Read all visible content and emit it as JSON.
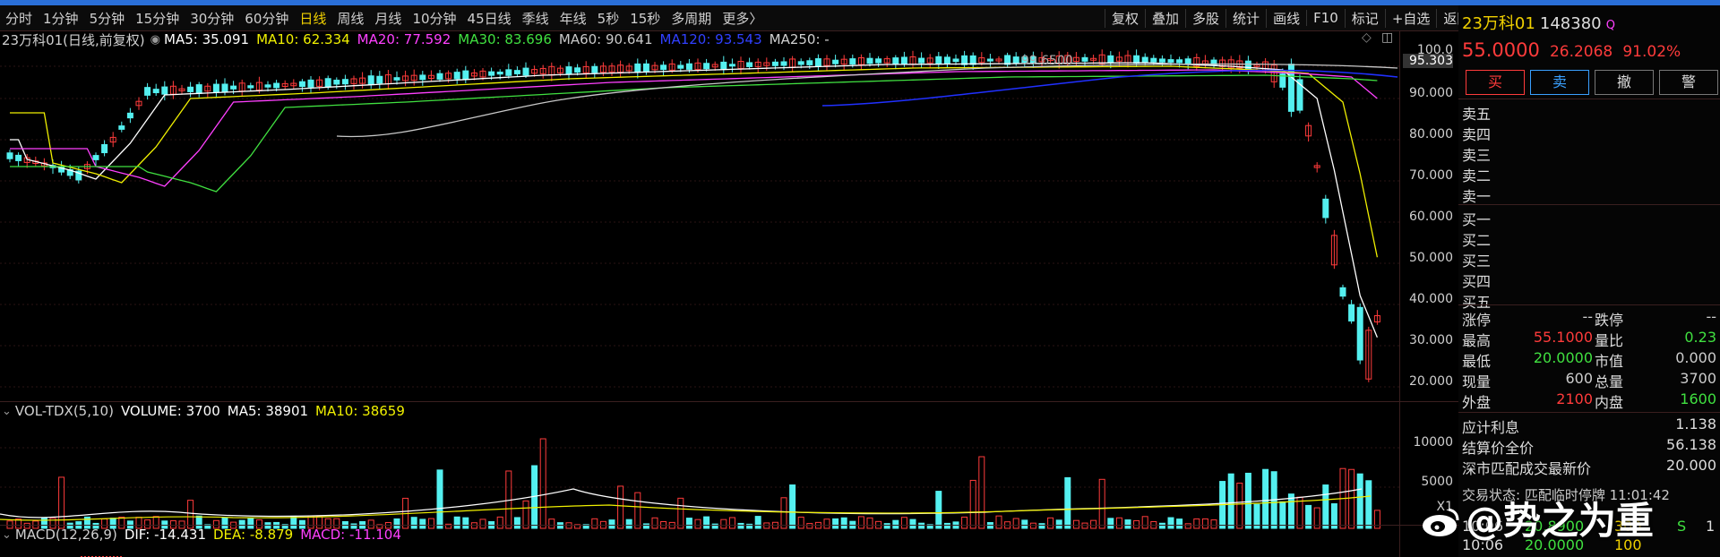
{
  "period_tabs": [
    "分时",
    "1分钟",
    "5分钟",
    "15分钟",
    "30分钟",
    "60分钟",
    "日线",
    "周线",
    "月线",
    "10分钟",
    "45日线",
    "季线",
    "年线",
    "5秒",
    "15秒",
    "多周期",
    "更多〉"
  ],
  "active_period": "日线",
  "toolbar": [
    "复权",
    "叠加",
    "多股",
    "统计",
    "画线",
    "F10",
    "标记",
    "+自选",
    "返回"
  ],
  "legend_main": {
    "title": "23万科01(日线,前复权)",
    "ma5": "MA5: 35.091",
    "ma10": "MA10: 62.334",
    "ma20": "MA20: 77.592",
    "ma30": "MA30: 83.696",
    "ma60": "MA60: 90.641",
    "ma120": "MA120: 93.543",
    "ma250": "MA250: -"
  },
  "legend_vol": {
    "title": "VOL-TDX(5,10)",
    "volume": "VOLUME: 3700",
    "ma5": "MA5: 38901",
    "ma10": "MA10: 38659"
  },
  "legend_macd": {
    "title": "MACD(12,26,9)",
    "dif": "DIF: -14.431",
    "dea": "DEA: -8.879",
    "macd": "MACD: -11.104"
  },
  "price_axis": [
    "100.0",
    "95.303",
    "90.000",
    "80.000",
    "70.000",
    "60.000",
    "50.000",
    "40.000",
    "30.000",
    "20.000"
  ],
  "vol_axis": [
    "10000",
    "5000",
    "X1"
  ],
  "chart_annotation": "99.6500",
  "colors": {
    "up": "#ff3b3b",
    "down": "#54f0f0",
    "ma5": "#ffffff",
    "ma10": "#f0f000",
    "ma20": "#ff40ff",
    "ma30": "#40e040",
    "ma60": "#c8c8c8",
    "ma120": "#2030ff",
    "active": "#f0d000"
  },
  "quote": {
    "name": "23万科01",
    "code": "148380",
    "q_icon": "Q",
    "price": "55.0000",
    "change": "26.2068",
    "pct": "91.02%",
    "buttons": [
      "买",
      "卖",
      "撤",
      "警"
    ],
    "sell_levels": [
      "卖五",
      "卖四",
      "卖三",
      "卖二",
      "卖一"
    ],
    "buy_levels": [
      "买一",
      "买二",
      "买三",
      "买四",
      "买五"
    ],
    "stats": [
      {
        "l1": "涨停",
        "v1": "--",
        "l2": "跌停",
        "v2": "--"
      },
      {
        "l1": "最高",
        "v1": "55.1000",
        "l2": "量比",
        "v2": "0.23"
      },
      {
        "l1": "最低",
        "v1": "20.0000",
        "l2": "市值",
        "v2": "0.000"
      },
      {
        "l1": "现量",
        "v1": "600",
        "l2": "总量",
        "v2": "3700"
      },
      {
        "l1": "外盘",
        "v1": "2100",
        "l2": "内盘",
        "v2": "1600"
      }
    ],
    "extra": [
      {
        "label": "应计利息",
        "value": "1.138"
      },
      {
        "label": "结算价全价",
        "value": "56.138"
      },
      {
        "label": "深市匹配成交最新价",
        "value": "20.000"
      }
    ],
    "trade_status": "交易状态: 匹配临时停牌 11:01:42",
    "ticks": [
      {
        "time": "10:06",
        "price": "20.8900",
        "vol": "300",
        "flag": "S",
        "n": "1"
      },
      {
        "time": "10:06",
        "price": "20.0000",
        "vol": "100",
        "flag": "",
        "n": ""
      }
    ]
  },
  "watermark": "@势之为重"
}
